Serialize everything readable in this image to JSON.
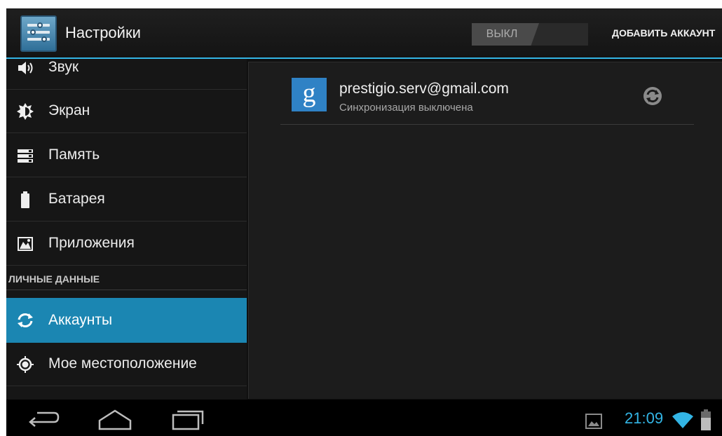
{
  "action_bar": {
    "title": "Настройки",
    "switch_label": "ВЫКЛ",
    "add_account_label": "ДОБАВИТЬ АККАУНТ"
  },
  "sidebar": {
    "items": [
      {
        "label": "Звук",
        "icon": "volume-icon"
      },
      {
        "label": "Экран",
        "icon": "brightness-icon"
      },
      {
        "label": "Память",
        "icon": "storage-icon"
      },
      {
        "label": "Батарея",
        "icon": "battery-icon"
      },
      {
        "label": "Приложения",
        "icon": "apps-icon"
      }
    ],
    "section_header": "ЛИЧНЫЕ ДАННЫЕ",
    "personal_items": [
      {
        "label": "Аккаунты",
        "icon": "sync-icon",
        "active": true
      },
      {
        "label": "Мое местоположение",
        "icon": "location-icon"
      }
    ]
  },
  "content": {
    "account": {
      "icon_letter": "g",
      "email": "prestigio.serv@gmail.com",
      "status": "Синхронизация выключена"
    }
  },
  "status_bar": {
    "time": "21:09"
  },
  "colors": {
    "accent": "#33b5e5",
    "active_item": "#1b86b2",
    "google_blue": "#2f82c5"
  }
}
